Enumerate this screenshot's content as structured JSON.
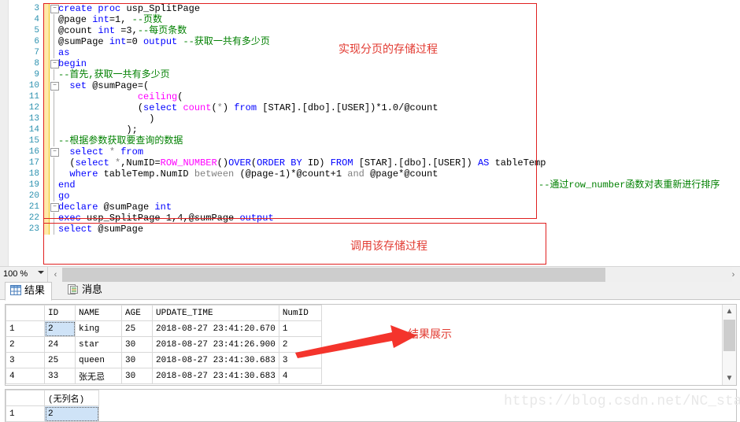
{
  "editor": {
    "lines": [
      {
        "num": "3",
        "fold": "minus",
        "indent": 0,
        "segments": [
          {
            "t": "create ",
            "c": "kw"
          },
          {
            "t": "proc ",
            "c": "kw"
          },
          {
            "t": "usp_SplitPage",
            "c": "id"
          }
        ]
      },
      {
        "num": "4",
        "fold": "",
        "indent": 1,
        "segments": [
          {
            "t": "@page ",
            "c": "id"
          },
          {
            "t": "int",
            "c": "kw"
          },
          {
            "t": "=1, ",
            "c": "id"
          },
          {
            "t": "--页数",
            "c": "cm"
          }
        ]
      },
      {
        "num": "5",
        "fold": "",
        "indent": 1,
        "segments": [
          {
            "t": "@count ",
            "c": "id"
          },
          {
            "t": "int ",
            "c": "kw"
          },
          {
            "t": "=3,",
            "c": "id"
          },
          {
            "t": "--每页条数",
            "c": "cm"
          }
        ]
      },
      {
        "num": "6",
        "fold": "",
        "indent": 1,
        "segments": [
          {
            "t": "@sumPage ",
            "c": "id"
          },
          {
            "t": "int",
            "c": "kw"
          },
          {
            "t": "=0 ",
            "c": "id"
          },
          {
            "t": "output ",
            "c": "kw"
          },
          {
            "t": "--获取一共有多少页",
            "c": "cm"
          }
        ]
      },
      {
        "num": "7",
        "fold": "",
        "indent": 1,
        "segments": [
          {
            "t": "as",
            "c": "kw"
          }
        ]
      },
      {
        "num": "8",
        "fold": "minus",
        "indent": 0,
        "segments": [
          {
            "t": "begin",
            "c": "kw"
          }
        ]
      },
      {
        "num": "9",
        "fold": "",
        "indent": 1,
        "segments": [
          {
            "t": "--首先,获取一共有多少页",
            "c": "cm"
          }
        ]
      },
      {
        "num": "10",
        "fold": "minus",
        "indent": 1,
        "segments": [
          {
            "t": "  set ",
            "c": "kw"
          },
          {
            "t": "@sumPage=(",
            "c": "id"
          }
        ]
      },
      {
        "num": "11",
        "fold": "",
        "indent": 1,
        "segments": [
          {
            "t": "              ",
            "c": "id"
          },
          {
            "t": "ceiling",
            "c": "fn"
          },
          {
            "t": "(",
            "c": "id"
          }
        ]
      },
      {
        "num": "12",
        "fold": "",
        "indent": 1,
        "segments": [
          {
            "t": "              (",
            "c": "id"
          },
          {
            "t": "select ",
            "c": "kw"
          },
          {
            "t": "count",
            "c": "fn"
          },
          {
            "t": "(",
            "c": "id"
          },
          {
            "t": "*",
            "c": "op"
          },
          {
            "t": ") ",
            "c": "id"
          },
          {
            "t": "from ",
            "c": "kw"
          },
          {
            "t": "[STAR].[dbo].[USER])*1.0/@count",
            "c": "id"
          }
        ]
      },
      {
        "num": "13",
        "fold": "",
        "indent": 1,
        "segments": [
          {
            "t": "                )",
            "c": "id"
          }
        ]
      },
      {
        "num": "14",
        "fold": "",
        "indent": 1,
        "segments": [
          {
            "t": "            );",
            "c": "id"
          }
        ]
      },
      {
        "num": "15",
        "fold": "",
        "indent": 1,
        "segments": [
          {
            "t": "--根据参数获取要查询的数据",
            "c": "cm"
          }
        ]
      },
      {
        "num": "16",
        "fold": "minus",
        "indent": 1,
        "segments": [
          {
            "t": "  select ",
            "c": "kw"
          },
          {
            "t": "* ",
            "c": "op"
          },
          {
            "t": "from",
            "c": "kw"
          }
        ]
      },
      {
        "num": "17",
        "fold": "",
        "indent": 1,
        "segments": [
          {
            "t": "  (",
            "c": "id"
          },
          {
            "t": "select ",
            "c": "kw"
          },
          {
            "t": "*",
            "c": "op"
          },
          {
            "t": ",NumID=",
            "c": "id"
          },
          {
            "t": "ROW_NUMBER",
            "c": "fn"
          },
          {
            "t": "()",
            "c": "id"
          },
          {
            "t": "OVER",
            "c": "kw"
          },
          {
            "t": "(",
            "c": "id"
          },
          {
            "t": "ORDER BY ",
            "c": "kw"
          },
          {
            "t": "ID) ",
            "c": "id"
          },
          {
            "t": "FROM ",
            "c": "kw"
          },
          {
            "t": "[STAR].[dbo].[USER]) ",
            "c": "id"
          },
          {
            "t": "AS ",
            "c": "kw"
          },
          {
            "t": "tableTemp",
            "c": "id"
          }
        ]
      },
      {
        "num": "18",
        "fold": "",
        "indent": 1,
        "segments": [
          {
            "t": "  where ",
            "c": "kw"
          },
          {
            "t": "tableTemp.NumID ",
            "c": "id"
          },
          {
            "t": "between ",
            "c": "op"
          },
          {
            "t": "(@page-1)*@count+1 ",
            "c": "id"
          },
          {
            "t": "and ",
            "c": "op"
          },
          {
            "t": "@page*@count",
            "c": "id"
          }
        ]
      },
      {
        "num": "19",
        "fold": "",
        "indent": 1,
        "segments": [
          {
            "t": "end",
            "c": "kw"
          }
        ]
      },
      {
        "num": "20",
        "fold": "",
        "indent": 1,
        "segments": [
          {
            "t": "go",
            "c": "kw"
          }
        ]
      },
      {
        "num": "21",
        "fold": "minus",
        "indent": 0,
        "segments": [
          {
            "t": "declare ",
            "c": "kw"
          },
          {
            "t": "@sumPage ",
            "c": "id"
          },
          {
            "t": "int",
            "c": "kw"
          }
        ]
      },
      {
        "num": "22",
        "fold": "",
        "indent": 1,
        "segments": [
          {
            "t": "exec ",
            "c": "kw"
          },
          {
            "t": "usp_SplitPage 1,4,@sumPage ",
            "c": "id"
          },
          {
            "t": "output",
            "c": "kw"
          }
        ]
      },
      {
        "num": "23",
        "fold": "",
        "indent": 1,
        "segments": [
          {
            "t": "select ",
            "c": "kw"
          },
          {
            "t": "@sumPage",
            "c": "id"
          }
        ]
      }
    ],
    "annotations": {
      "proc_note": "实现分页的存储过程",
      "row_number_note": "--通过row_number函数对表重新进行排序",
      "call_note": "调用该存储过程",
      "results_note": "结果展示"
    },
    "colors": {
      "annotation_red": "#e23b32",
      "comment_green": "#008000",
      "keyword_blue": "#0000ff",
      "function_magenta": "#ff00ff",
      "linenumber_teal": "#2b91af",
      "changebar_yellow": "#ffe9a8",
      "box_red": "#e02020"
    }
  },
  "statusbar": {
    "zoom_level": "100 %",
    "scroll_left_arrow": "‹",
    "scroll_right_arrow": "›"
  },
  "result_tabs": [
    {
      "label": "结果",
      "icon": "grid-icon",
      "active": true
    },
    {
      "label": "消息",
      "icon": "message-icon",
      "active": false
    }
  ],
  "grid1": {
    "columns": [
      "",
      "ID",
      "NAME",
      "AGE",
      "UPDATE_TIME",
      "NumID"
    ],
    "rows": [
      {
        "n": "1",
        "ID": "2",
        "NAME": "king",
        "AGE": "25",
        "UPDATE_TIME": "2018-08-27 23:41:20.670",
        "NumID": "1",
        "selected": true
      },
      {
        "n": "2",
        "ID": "24",
        "NAME": "star",
        "AGE": "30",
        "UPDATE_TIME": "2018-08-27 23:41:26.900",
        "NumID": "2",
        "selected": false
      },
      {
        "n": "3",
        "ID": "25",
        "NAME": "queen",
        "AGE": "30",
        "UPDATE_TIME": "2018-08-27 23:41:30.683",
        "NumID": "3",
        "selected": false
      },
      {
        "n": "4",
        "ID": "33",
        "NAME": "张无忌",
        "AGE": "30",
        "UPDATE_TIME": "2018-08-27 23:41:30.683",
        "NumID": "4",
        "selected": false
      }
    ],
    "scrollbar": {
      "up": "▲",
      "down": "▼"
    }
  },
  "grid2": {
    "columns": [
      "",
      "(无列名)"
    ],
    "rows": [
      {
        "n": "1",
        "value": "2",
        "selected": true
      }
    ]
  },
  "watermark": "https://blog.csdn.net/NC_star"
}
